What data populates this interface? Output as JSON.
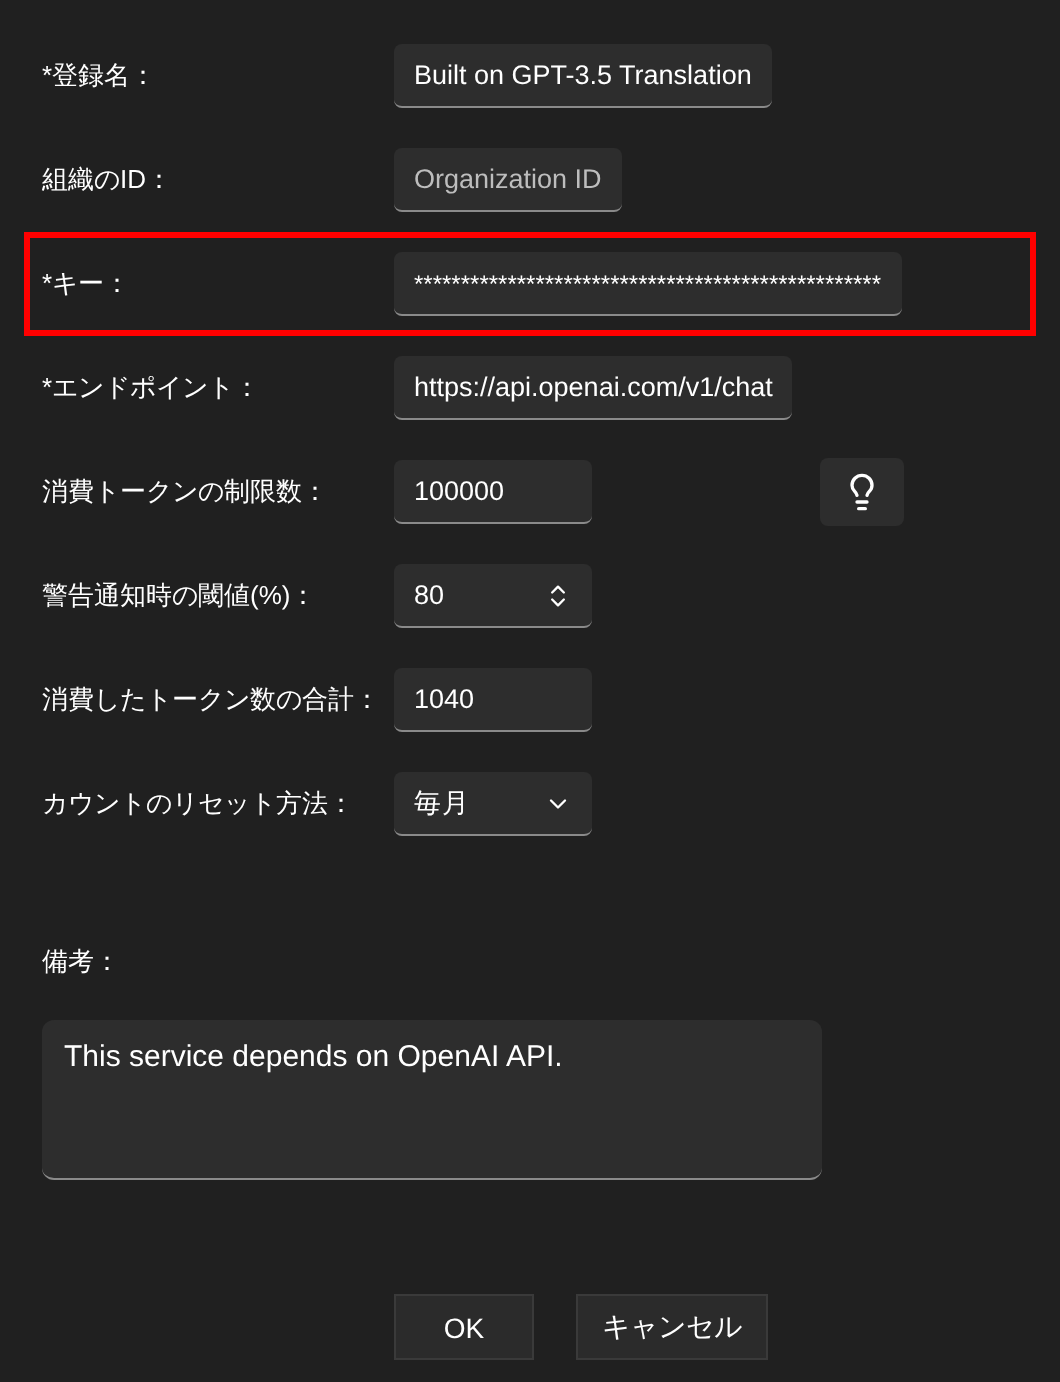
{
  "fields": [
    {
      "label": "*登録名：",
      "kind": "text",
      "value": "Built on GPT-3.5 Translation",
      "highlighted": false
    },
    {
      "label": "組織のID：",
      "kind": "text",
      "placeholder": "Organization ID",
      "highlighted": false
    },
    {
      "label": "*キー：",
      "kind": "text",
      "value": "**************************************************",
      "highlighted": true
    },
    {
      "label": "*エンドポイント：",
      "kind": "text",
      "value": "https://api.openai.com/v1/chat",
      "highlighted": false
    },
    {
      "label": "消費トークンの制限数：",
      "kind": "number",
      "value": "100000",
      "highlighted": false,
      "hint_button": true
    },
    {
      "label": "警告通知時の閾値(%)：",
      "kind": "spinner",
      "value": "80",
      "highlighted": false
    },
    {
      "label": "消費したトークン数の合計：",
      "kind": "number",
      "value": "1040",
      "highlighted": false
    },
    {
      "label": "カウントのリセット方法：",
      "kind": "dropdown",
      "value": "毎月",
      "highlighted": false
    }
  ],
  "notes": {
    "label": "備考：",
    "value": "This service depends on OpenAI API."
  },
  "buttons": [
    "OK",
    "キャンセル"
  ]
}
